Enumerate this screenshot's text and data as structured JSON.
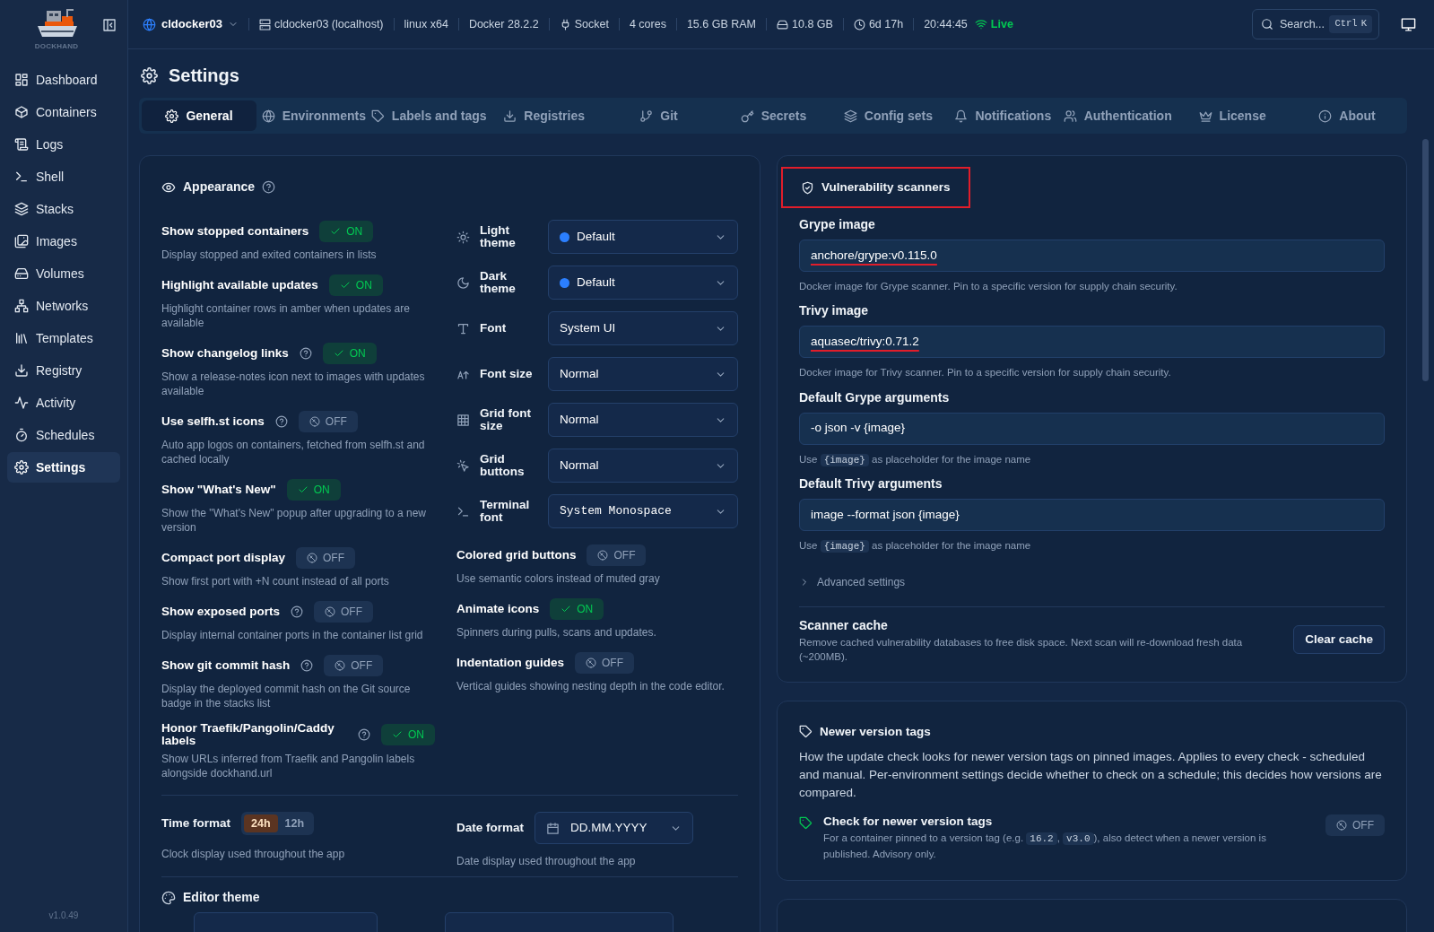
{
  "app": {
    "logo_text": "DOCKHAND",
    "version": "v1.0.49"
  },
  "sidebar": {
    "items": [
      {
        "label": "Dashboard",
        "selected": false
      },
      {
        "label": "Containers",
        "selected": false
      },
      {
        "label": "Logs",
        "selected": false
      },
      {
        "label": "Shell",
        "selected": false
      },
      {
        "label": "Stacks",
        "selected": false
      },
      {
        "label": "Images",
        "selected": false
      },
      {
        "label": "Volumes",
        "selected": false
      },
      {
        "label": "Networks",
        "selected": false
      },
      {
        "label": "Templates",
        "selected": false
      },
      {
        "label": "Registry",
        "selected": false
      },
      {
        "label": "Activity",
        "selected": false
      },
      {
        "label": "Schedules",
        "selected": false
      },
      {
        "label": "Settings",
        "selected": true
      }
    ]
  },
  "top_bar": {
    "environment": "cldocker03",
    "info": [
      {
        "text": "cldocker03 (localhost)",
        "kind": "server"
      },
      {
        "text": "linux x64",
        "kind": "plain"
      },
      {
        "text": "Docker 28.2.2",
        "kind": "plain"
      },
      {
        "text": "Socket",
        "kind": "socket"
      },
      {
        "text": "4 cores",
        "kind": "plain"
      },
      {
        "text": "15.6 GB RAM",
        "kind": "plain"
      },
      {
        "text": "10.8 GB",
        "kind": "disk"
      },
      {
        "text": "6d 17h",
        "kind": "clock"
      },
      {
        "text": "20:44:45",
        "kind": "plain"
      }
    ],
    "connection": {
      "text": "Live",
      "live": true
    },
    "search": {
      "placeholder": "Search...",
      "shortcut": [
        "Ctrl",
        "K"
      ]
    }
  },
  "page": {
    "title": "Settings"
  },
  "tabs": [
    {
      "label": "General",
      "selected": true
    },
    {
      "label": "Environments",
      "selected": false
    },
    {
      "label": "Labels and tags",
      "selected": false
    },
    {
      "label": "Registries",
      "selected": false
    },
    {
      "label": "Git",
      "selected": false
    },
    {
      "label": "Secrets",
      "selected": false
    },
    {
      "label": "Config sets",
      "selected": false
    },
    {
      "label": "Notifications",
      "selected": false
    },
    {
      "label": "Authentication",
      "selected": false
    },
    {
      "label": "License",
      "selected": false
    },
    {
      "label": "About",
      "selected": false
    }
  ],
  "appearance": {
    "title": "Appearance",
    "toggles": [
      {
        "label": "Show stopped containers",
        "help": false,
        "on": true,
        "state_text": "ON",
        "description": "Display stopped and exited containers in lists"
      },
      {
        "label": "Highlight available updates",
        "help": false,
        "on": true,
        "state_text": "ON",
        "description": "Highlight container rows in amber when updates are available"
      },
      {
        "label": "Show changelog links",
        "help": true,
        "on": true,
        "state_text": "ON",
        "description": "Show a release-notes icon next to images with updates available"
      },
      {
        "label": "Use selfh.st icons",
        "help": true,
        "on": false,
        "state_text": "OFF",
        "description": "Auto app logos on containers, fetched from selfh.st and cached locally"
      },
      {
        "label": "Show \"What's New\"",
        "help": false,
        "on": true,
        "state_text": "ON",
        "description": "Show the \"What's New\" popup after upgrading to a new version"
      },
      {
        "label": "Compact port display",
        "help": false,
        "on": false,
        "state_text": "OFF",
        "description": "Show first port with +N count instead of all ports"
      },
      {
        "label": "Show exposed ports",
        "help": true,
        "on": false,
        "state_text": "OFF",
        "description": "Display internal container ports in the container list grid"
      },
      {
        "label": "Show git commit hash",
        "help": true,
        "on": false,
        "state_text": "OFF",
        "description": "Display the deployed commit hash on the Git source badge in the stacks list"
      },
      {
        "label": "Honor Traefik/Pangolin/Caddy labels",
        "help": true,
        "on": true,
        "state_text": "ON",
        "description": "Show URLs inferred from Traefik and Pangolin labels alongside dockhand.url"
      }
    ],
    "selects": [
      {
        "label": "Light theme",
        "value": "Default",
        "dot": true,
        "mono": false
      },
      {
        "label": "Dark theme",
        "value": "Default",
        "dot": true,
        "mono": false
      },
      {
        "label": "Font",
        "value": "System UI",
        "dot": false,
        "mono": false
      },
      {
        "label": "Font size",
        "value": "Normal",
        "dot": false,
        "mono": false
      },
      {
        "label": "Grid font size",
        "value": "Normal",
        "dot": false,
        "mono": false
      },
      {
        "label": "Grid buttons",
        "value": "Normal",
        "dot": false,
        "mono": false
      },
      {
        "label": "Terminal font",
        "value": "System Monospace",
        "dot": false,
        "mono": true
      }
    ],
    "toggles_right": [
      {
        "label": "Colored grid buttons",
        "help": false,
        "on": false,
        "state_text": "OFF",
        "description": "Use semantic colors instead of muted gray"
      },
      {
        "label": "Animate icons",
        "help": false,
        "on": true,
        "state_text": "ON",
        "description": "Spinners during pulls, scans and updates."
      },
      {
        "label": "Indentation guides",
        "help": false,
        "on": false,
        "state_text": "OFF",
        "description": "Vertical guides showing nesting depth in the code editor."
      }
    ],
    "time_format": {
      "label": "Time format",
      "options": [
        {
          "label": "24h",
          "selected": true
        },
        {
          "label": "12h",
          "selected": false
        }
      ],
      "description": "Clock display used throughout the app"
    },
    "date_format": {
      "label": "Date format",
      "value": "DD.MM.YYYY",
      "description": "Date display used throughout the app"
    },
    "editor_theme": {
      "title": "Editor theme"
    }
  },
  "scanners": {
    "title": "Vulnerability scanners",
    "highlighted": true,
    "fields": [
      {
        "label": "Grype image",
        "value": "anchore/grype:v0.115.0",
        "spell_error": true,
        "hint": [
          {
            "kind": "text",
            "text": "Docker image for Grype scanner. Pin to a specific version for supply chain security."
          }
        ]
      },
      {
        "label": "Trivy image",
        "value": "aquasec/trivy:0.71.2",
        "spell_error": true,
        "hint": [
          {
            "kind": "text",
            "text": "Docker image for Trivy scanner. Pin to a specific version for supply chain security."
          }
        ]
      },
      {
        "label": "Default Grype arguments",
        "value": "-o json -v {image}",
        "spell_error": false,
        "hint": [
          {
            "kind": "text",
            "text": "Use "
          },
          {
            "kind": "code",
            "text": "{image}"
          },
          {
            "kind": "text",
            "text": " as placeholder for the image name"
          }
        ]
      },
      {
        "label": "Default Trivy arguments",
        "value": "image --format json {image}",
        "spell_error": false,
        "hint": [
          {
            "kind": "text",
            "text": "Use "
          },
          {
            "kind": "code",
            "text": "{image}"
          },
          {
            "kind": "text",
            "text": " as placeholder for the image name"
          }
        ]
      }
    ],
    "advanced": {
      "label": "Advanced settings",
      "expanded": false
    },
    "cache": {
      "title": "Scanner cache",
      "description": "Remove cached vulnerability databases to free disk space. Next scan will re-download fresh data (~200MB).",
      "button": "Clear cache"
    }
  },
  "version_tags": {
    "title": "Newer version tags",
    "description": "How the update check looks for newer version tags on pinned images. Applies to every check - scheduled and manual. Per-environment settings decide whether to check on a schedule; this decides how versions are compared.",
    "setting": {
      "label": "Check for newer version tags",
      "on": false,
      "state_text": "OFF",
      "description": [
        {
          "kind": "text",
          "text": "For a container pinned to a version tag (e.g. "
        },
        {
          "kind": "code",
          "text": "16.2"
        },
        {
          "kind": "text",
          "text": ", "
        },
        {
          "kind": "code",
          "text": "v3.0"
        },
        {
          "kind": "text",
          "text": "), also detect when a newer version is published. Advisory only."
        }
      ]
    }
  }
}
